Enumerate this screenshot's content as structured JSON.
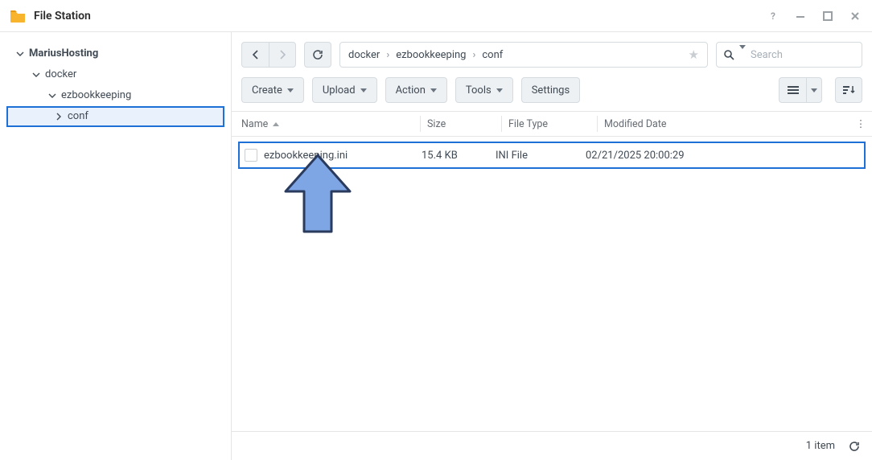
{
  "app": {
    "title": "File Station"
  },
  "tree": {
    "root": "MariusHosting",
    "lvl1": "docker",
    "lvl2": "ezbookkeeping",
    "lvl3": "conf"
  },
  "path": {
    "seg1": "docker",
    "seg2": "ezbookkeeping",
    "seg3": "conf"
  },
  "search": {
    "placeholder": "Search"
  },
  "toolbar": {
    "create": "Create",
    "upload": "Upload",
    "action": "Action",
    "tools": "Tools",
    "settings": "Settings"
  },
  "columns": {
    "name": "Name",
    "size": "Size",
    "type": "File Type",
    "modified": "Modified Date"
  },
  "file": {
    "name": "ezbookkeeping.ini",
    "size": "15.4 KB",
    "type": "INI File",
    "modified": "02/21/2025 20:00:29"
  },
  "status": {
    "count": "1 item"
  }
}
